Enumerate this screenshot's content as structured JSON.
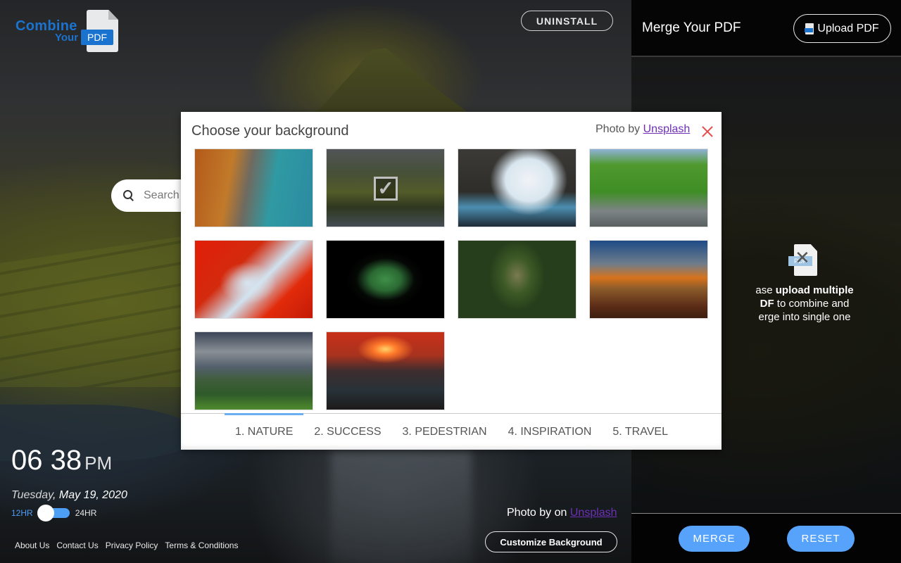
{
  "logo": {
    "word1": "Combine",
    "word2": "Your",
    "tag": "PDF"
  },
  "header": {
    "uninstall_label": "UNINSTALL"
  },
  "search": {
    "placeholder": "Search"
  },
  "clock": {
    "time": "06 38",
    "ampm": "PM",
    "day": "Tuesday",
    "date": "May 19, 2020",
    "format_12": "12HR",
    "format_24": "24HR",
    "format_selected": "12HR"
  },
  "footer": {
    "links": [
      "About Us",
      "Contact Us",
      "Privacy Policy",
      "Terms & Conditions"
    ]
  },
  "credit": {
    "prefix": "Photo by on",
    "link": "Unsplash"
  },
  "customize_label": "Customize Background",
  "panel": {
    "title": "Merge Your PDF",
    "upload_label": "Upload PDF",
    "empty_icon_tag": "PDF",
    "empty_text_pre": "ase ",
    "empty_text_bold1": "upload multiple",
    "empty_text_bold2": "DF",
    "empty_text_mid": " to combine and",
    "empty_text_end": "erge into single one",
    "merge_label": "MERGE",
    "reset_label": "RESET"
  },
  "modal": {
    "title": "Choose your background",
    "credit_prefix": "Photo by",
    "credit_link": "Unsplash",
    "thumbnails": [
      {
        "subject": "autumn canyon lake boardwalk",
        "selected": false
      },
      {
        "subject": "green mountain with waterfall",
        "selected": true
      },
      {
        "subject": "sea cave arch with boat",
        "selected": false
      },
      {
        "subject": "green forest river",
        "selected": false
      },
      {
        "subject": "red autumn leaves against sky",
        "selected": false
      },
      {
        "subject": "lotus leaves reflection on black",
        "selected": false
      },
      {
        "subject": "large tree in green forest",
        "selected": false
      },
      {
        "subject": "castle at sunset",
        "selected": false
      },
      {
        "subject": "cliff castle ruins by sea",
        "selected": false
      },
      {
        "subject": "sunset sea stacks coast",
        "selected": false
      }
    ],
    "check_glyph": "✓",
    "tabs": [
      "1. NATURE",
      "2. SUCCESS",
      "3. PEDESTRIAN",
      "4. INSPIRATION",
      "5. TRAVEL"
    ],
    "active_tab": "1. NATURE"
  },
  "colors": {
    "accent": "#57a3fb",
    "logo_blue": "#1b73d0",
    "close_red": "#e74a4a",
    "link_purple": "#6e2fb7"
  }
}
